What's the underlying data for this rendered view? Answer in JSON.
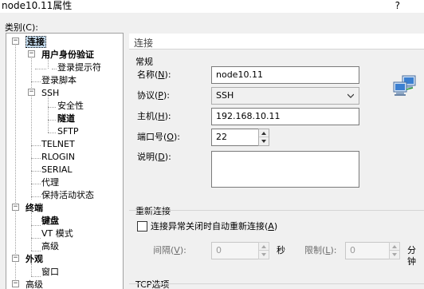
{
  "window": {
    "title": "node10.11属性",
    "help_glyph": "?"
  },
  "category_label": "类别(C):",
  "tree": {
    "items": [
      {
        "label": "连接"
      },
      {
        "label": "用户身份验证"
      },
      {
        "label": "登录提示符"
      },
      {
        "label": "登录脚本"
      },
      {
        "label": "SSH"
      },
      {
        "label": "安全性"
      },
      {
        "label": "隧道"
      },
      {
        "label": "SFTP"
      },
      {
        "label": "TELNET"
      },
      {
        "label": "RLOGIN"
      },
      {
        "label": "SERIAL"
      },
      {
        "label": "代理"
      },
      {
        "label": "保持活动状态"
      },
      {
        "label": "终端"
      },
      {
        "label": "键盘"
      },
      {
        "label": "VT 模式"
      },
      {
        "label": "高级"
      },
      {
        "label": "外观"
      },
      {
        "label": "窗口"
      },
      {
        "label": "高级"
      }
    ],
    "expander_minus": "−"
  },
  "panel": {
    "header": "连接",
    "general": {
      "section": "常规",
      "name_label": "名称(",
      "name_key": "N",
      "name_tail": "):",
      "name_value": "node10.11",
      "protocol_label": "协议(",
      "protocol_key": "P",
      "protocol_tail": "):",
      "protocol_value": "SSH",
      "host_label": "主机(",
      "host_key": "H",
      "host_tail": "):",
      "host_value": "192.168.10.11",
      "port_label": "端口号(",
      "port_key": "O",
      "port_tail": "):",
      "port_value": "22",
      "desc_label": "说明(",
      "desc_key": "D",
      "desc_tail": "):"
    },
    "reconnect": {
      "section": "重新连接",
      "checkbox_label": "连接异常关闭时自动重新连接(",
      "checkbox_key": "A",
      "checkbox_tail": ")",
      "interval_label": "间隔(",
      "interval_key": "V",
      "interval_tail": "):",
      "interval_value": "0",
      "interval_unit": "秒",
      "limit_label": "限制(",
      "limit_key": "L",
      "limit_tail": "):",
      "limit_value": "0",
      "limit_unit": "分钟"
    },
    "tcp": {
      "section": "TCP选项"
    }
  }
}
